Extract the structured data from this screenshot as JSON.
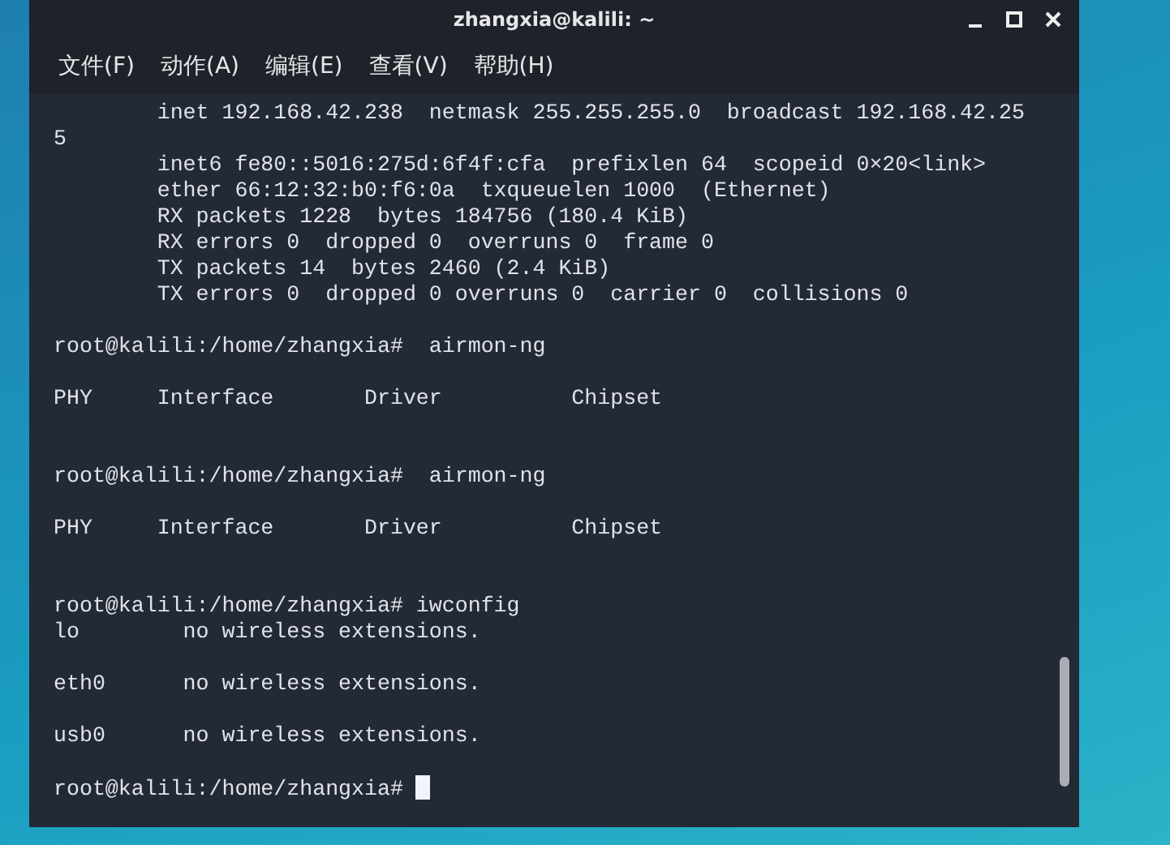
{
  "window": {
    "title": "zhangxia@kalili: ~"
  },
  "menu": [
    "文件(F)",
    "动作(A)",
    "编辑(E)",
    "查看(V)",
    "帮助(H)"
  ],
  "terminal": {
    "lines": [
      {
        "kind": "output",
        "text": "        inet 192.168.42.238  netmask 255.255.255.0  broadcast 192.168.42.25"
      },
      {
        "kind": "output",
        "text": "5"
      },
      {
        "kind": "output",
        "text": "        inet6 fe80::5016:275d:6f4f:cfa  prefixlen 64  scopeid 0×20<link>"
      },
      {
        "kind": "output",
        "text": "        ether 66:12:32:b0:f6:0a  txqueuelen 1000  (Ethernet)"
      },
      {
        "kind": "output",
        "text": "        RX packets 1228  bytes 184756 (180.4 KiB)"
      },
      {
        "kind": "output",
        "text": "        RX errors 0  dropped 0  overruns 0  frame 0"
      },
      {
        "kind": "output",
        "text": "        TX packets 14  bytes 2460 (2.4 KiB)"
      },
      {
        "kind": "output",
        "text": "        TX errors 0  dropped 0 overruns 0  carrier 0  collisions 0"
      },
      {
        "kind": "blank"
      },
      {
        "kind": "command",
        "text": "root@kalili:/home/zhangxia#  airmon-ng"
      },
      {
        "kind": "blank"
      },
      {
        "kind": "output",
        "text": "PHY     Interface       Driver          Chipset"
      },
      {
        "kind": "blank"
      },
      {
        "kind": "blank"
      },
      {
        "kind": "command",
        "text": "root@kalili:/home/zhangxia#  airmon-ng"
      },
      {
        "kind": "blank"
      },
      {
        "kind": "output",
        "text": "PHY     Interface       Driver          Chipset"
      },
      {
        "kind": "blank"
      },
      {
        "kind": "blank"
      },
      {
        "kind": "command",
        "text": "root@kalili:/home/zhangxia# iwconfig"
      },
      {
        "kind": "output",
        "text": "lo        no wireless extensions."
      },
      {
        "kind": "blank"
      },
      {
        "kind": "output",
        "text": "eth0      no wireless extensions."
      },
      {
        "kind": "blank"
      },
      {
        "kind": "output",
        "text": "usb0      no wireless extensions."
      },
      {
        "kind": "blank"
      },
      {
        "kind": "command",
        "text": "root@kalili:/home/zhangxia# ",
        "cursor": true
      }
    ]
  }
}
